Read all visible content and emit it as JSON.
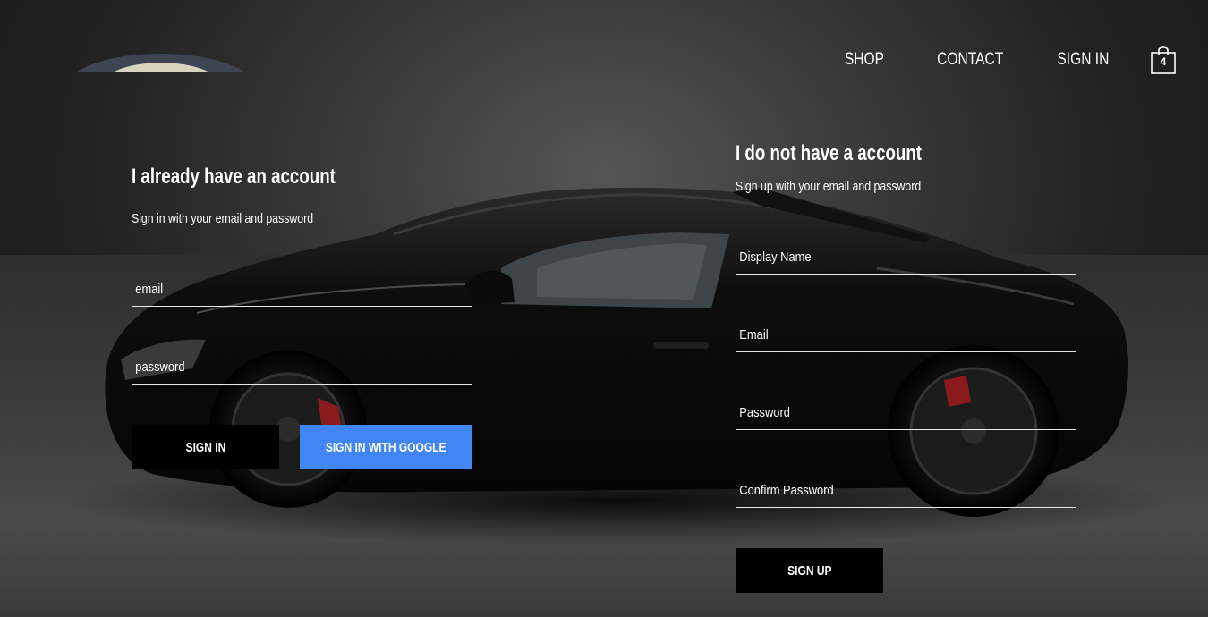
{
  "nav": {
    "shop": "SHOP",
    "contact": "CONTACT",
    "sign_in": "SIGN IN",
    "cart_count": "4",
    "cart_icon": "shopping-bag-icon"
  },
  "sign_in": {
    "title": "I already have an account",
    "subtitle": "Sign in with your email and password",
    "email_placeholder": "email",
    "password_placeholder": "password",
    "sign_in_button": "SIGN IN",
    "google_button": "SIGN IN WITH GOOGLE"
  },
  "sign_up": {
    "title": "I do not have a account",
    "subtitle": "Sign up with your email and password",
    "display_name_placeholder": "Display Name",
    "email_placeholder": "Email",
    "password_placeholder": "Password",
    "confirm_password_placeholder": "Confirm Password",
    "sign_up_button": "SIGN UP"
  },
  "colors": {
    "google_blue": "#4285f4",
    "button_black": "#000000",
    "text": "#ffffff"
  }
}
